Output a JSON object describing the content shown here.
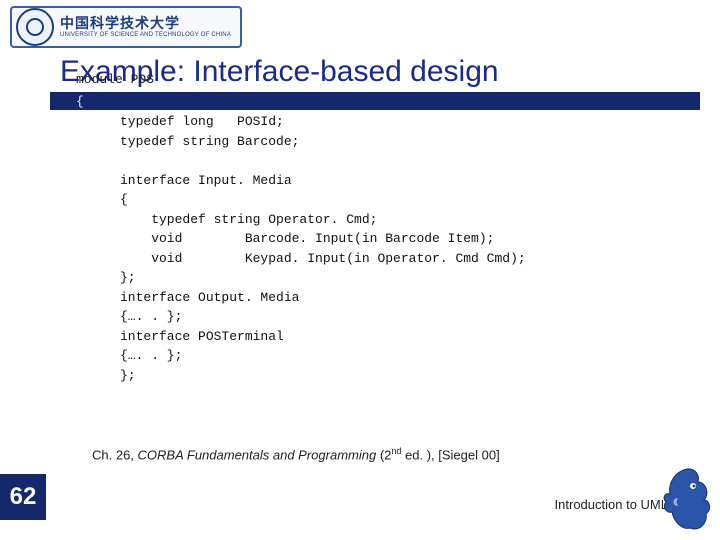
{
  "logo": {
    "cn": "中国科学技术大学",
    "en": "UNIVERSITY OF SCIENCE AND TECHNOLOGY OF CHINA"
  },
  "title": "Example: Interface-based design",
  "overlay": "module POS",
  "brace": "{",
  "code": {
    "l1": "typedef long   POSId;",
    "l2": "typedef string Barcode;",
    "l3": "",
    "l4": "interface Input. Media",
    "l5": "{",
    "l6": "    typedef string Operator. Cmd;",
    "l7": "    void        Barcode. Input(in Barcode Item);",
    "l8": "    void        Keypad. Input(in Operator. Cmd Cmd);",
    "l9": "};",
    "l10": "interface Output. Media",
    "l11": "{…. . };",
    "l12": "interface POSTerminal",
    "l13": "{…. . };",
    "l14": "};"
  },
  "citation": {
    "prefix": "Ch. 26, ",
    "book": "CORBA Fundamentals and Programming",
    "edition_open": " (2",
    "edition_sup": "nd",
    "edition_close": " ed. ), [Siegel 00]"
  },
  "page_number": "62",
  "footer": "Introduction to UML"
}
